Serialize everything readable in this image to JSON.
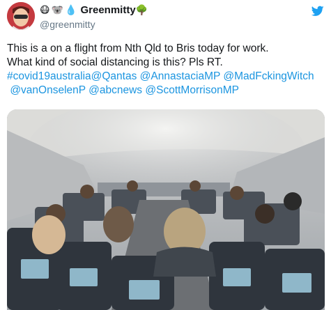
{
  "user": {
    "emojis": [
      "😷",
      "🐨",
      "💧"
    ],
    "display_name": "Greenmitty",
    "name_emoji": "🌳",
    "handle": "@greenmitty"
  },
  "tweet": {
    "line1": "This is a on a flight from Nth Qld to Bris today for work.",
    "line2": "What kind of social distancing is this? Pls RT.",
    "hashtag": "#covid19australia",
    "mentions": [
      "@Qantas",
      "@AnnastaciaMP",
      "@MadFckingWitch",
      "@vanOnselenP",
      "@abcnews",
      "@ScottMorrisonMP"
    ]
  },
  "icons": {
    "brand": "twitter-bird-icon"
  },
  "colors": {
    "link": "#1b95e0",
    "brand": "#1da1f2",
    "text": "#14171a",
    "muted": "#657786"
  },
  "media": {
    "alt": "packed airplane cabin full of passengers"
  }
}
